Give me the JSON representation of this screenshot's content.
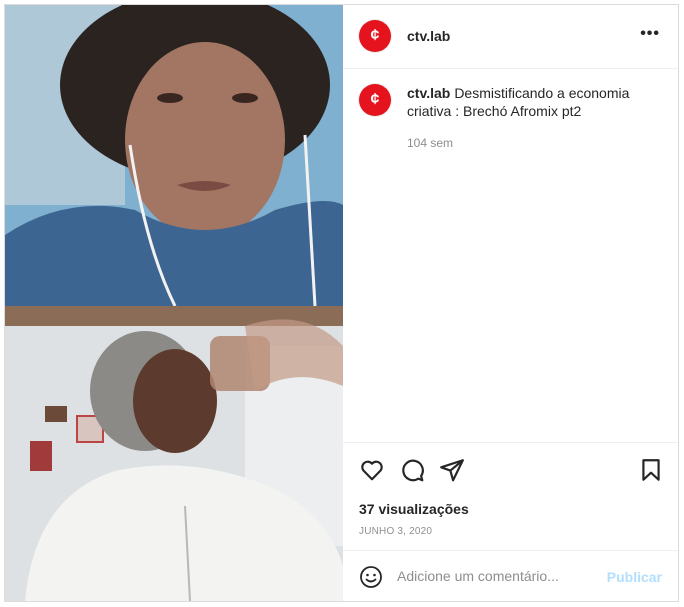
{
  "account": {
    "username": "ctv.lab",
    "avatar_glyph": "¢",
    "avatar_color": "#e4131d"
  },
  "header": {
    "more_label": "•••"
  },
  "caption": {
    "username": "ctv.lab",
    "text": "Desmistificando a economia criativa : Brechó Afromix pt2",
    "time_ago": "104 sem"
  },
  "media": {
    "type": "video",
    "tiles": [
      {
        "name": "top-participant",
        "palette": "#4f7fa8"
      },
      {
        "name": "bottom-participant",
        "palette": "#e2e5e7"
      }
    ]
  },
  "actions": {
    "like_icon": "heart-icon",
    "comment_icon": "comment-icon",
    "share_icon": "paper-plane-icon",
    "save_icon": "bookmark-icon"
  },
  "stats": {
    "views": "37 visualizações",
    "date": "JUNHO 3, 2020"
  },
  "comment": {
    "placeholder": "Adicione um comentário...",
    "post_label": "Publicar",
    "emoji_icon": "emoji-icon"
  },
  "colors": {
    "muted": "#8e8e8e",
    "post_button_disabled": "#b2dffc",
    "text": "#262626"
  }
}
